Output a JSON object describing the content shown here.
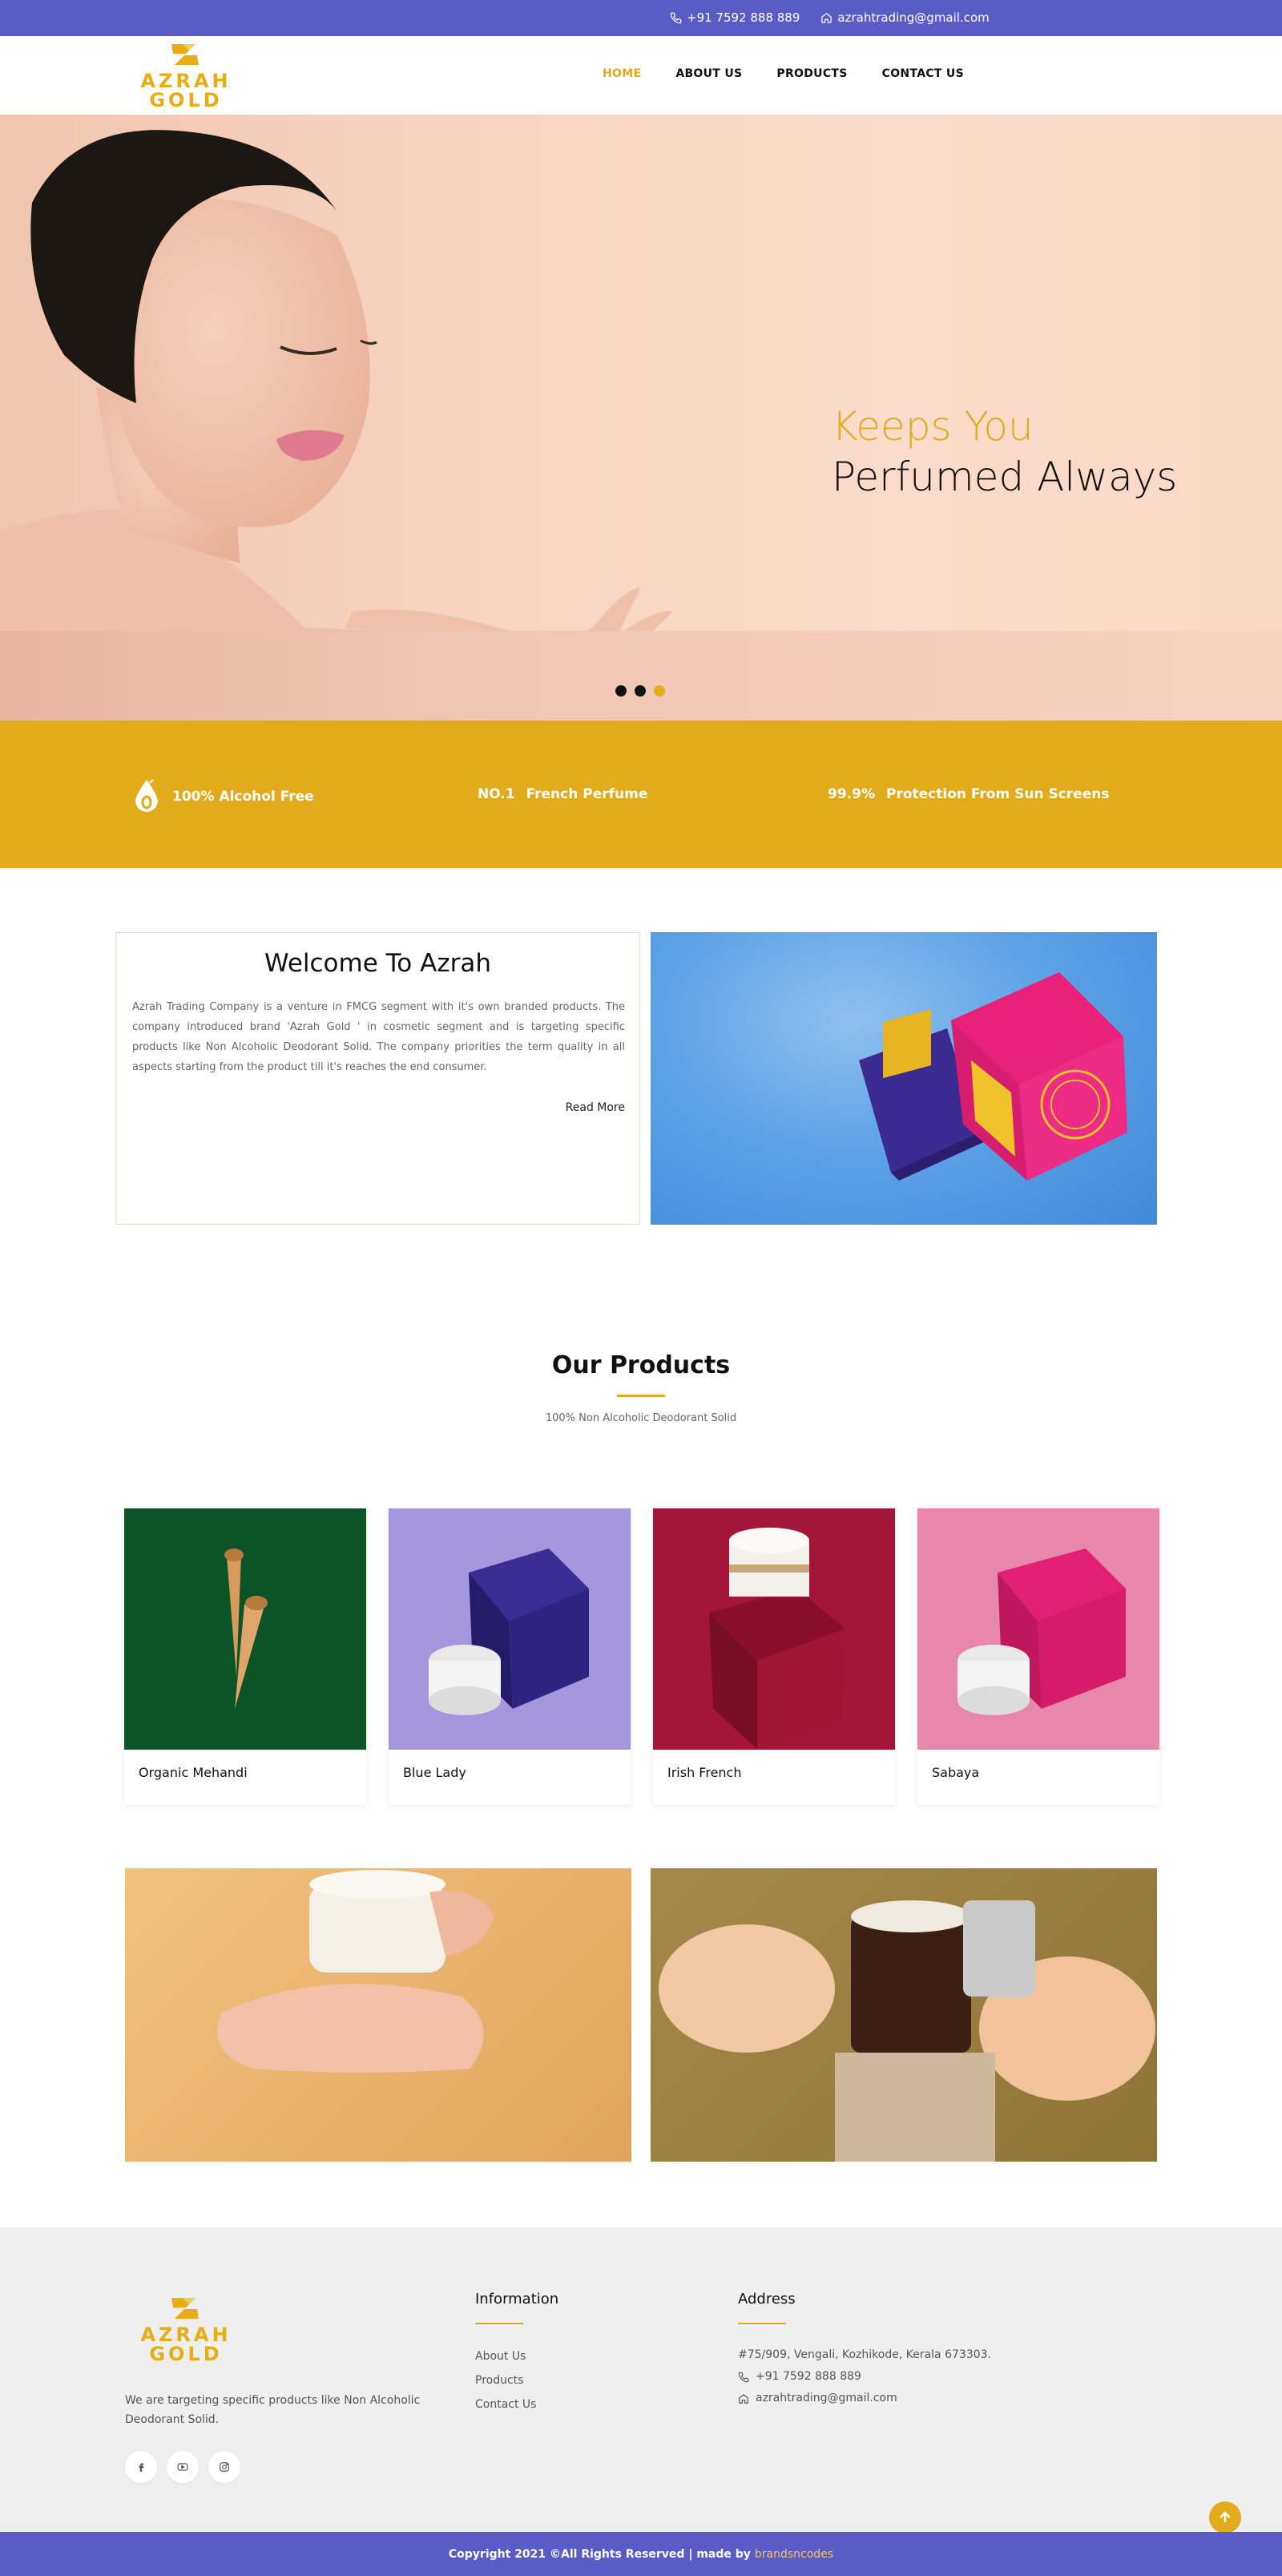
{
  "topbar": {
    "phone": "+91 7592 888 889",
    "email": "azrahtrading@gmail.com"
  },
  "brand": {
    "line1": "AZRAH",
    "line2": "GOLD"
  },
  "nav": {
    "items": [
      "HOME",
      "ABOUT US",
      "PRODUCTS",
      "CONTACT US"
    ],
    "active": "HOME"
  },
  "hero": {
    "title_line1": "Keeps You",
    "title_line2": "Perfumed Always",
    "slide_count": 3,
    "active_slide": 3
  },
  "features": [
    {
      "prefix": "",
      "text": "100% Alcohol Free",
      "icon": "drop-icon"
    },
    {
      "prefix": "NO.1",
      "text": "French Perfume"
    },
    {
      "prefix": "99.9%",
      "text": "Protection From Sun Screens"
    }
  ],
  "welcome": {
    "title": "Welcome To Azrah",
    "body": "Azrah Trading Company is a venture in FMCG segment with it's own branded products. The company introduced brand 'Azrah Gold ' in cosmetic segment and is targeting specific products like Non Alcoholic Deodorant Solid. The company priorities the term quality in all aspects starting from the product till it's reaches the end consumer.",
    "read_more": "Read More"
  },
  "products": {
    "title": "Our Products",
    "subtitle": "100% Non Alcoholic Deodorant Solid",
    "items": [
      {
        "name": "Organic Mehandi"
      },
      {
        "name": "Blue Lady"
      },
      {
        "name": "Irish French"
      },
      {
        "name": "Sabaya"
      }
    ]
  },
  "footer": {
    "about": "We are targeting specific products like Non Alcoholic Deodorant Solid.",
    "social": [
      "facebook-icon",
      "youtube-icon",
      "instagram-icon"
    ],
    "info_title": "Information",
    "links": [
      "About Us",
      "Products",
      "Contact Us"
    ],
    "address_title": "Address",
    "address": "#75/909, Vengali, Kozhikode, Kerala 673303.",
    "phone": "+91 7592 888 889",
    "email": "azrahtrading@gmail.com"
  },
  "copyright": {
    "text": "Copyright 2021 ©All Rights Reserved | made by",
    "brand": "brandsncodes"
  },
  "colors": {
    "accent": "#e2ab1b",
    "primary": "#5b5bc8"
  }
}
